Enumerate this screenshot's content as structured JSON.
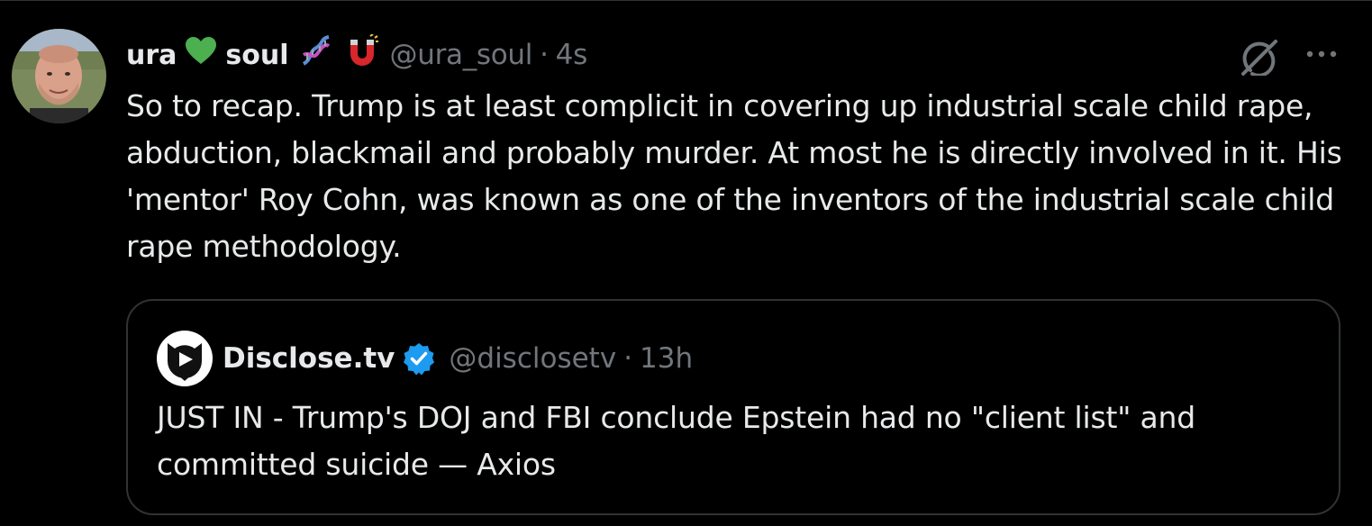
{
  "tweet": {
    "author_name_first": "ura",
    "author_name_second": "soul",
    "handle": "@ura_soul",
    "separator": "·",
    "time": "4s",
    "text": "So to recap. Trump is at least complicit in covering up industrial scale child rape, abduction, blackmail and probably murder. At most he is directly involved in it. His 'mentor' Roy Cohn, was known as one of the inventors of the industrial scale child rape methodology.",
    "name_emojis": [
      "green-heart-icon",
      "dna-icon",
      "magnet-icon"
    ]
  },
  "quote": {
    "author_name": "Disclose.tv",
    "handle": "@disclosetv",
    "separator": "·",
    "time": "13h",
    "text": "JUST IN - Trump's DOJ and FBI conclude Epstein had no \"client list\" and committed suicide — Axios",
    "verified": true
  },
  "actions": {
    "grok_icon": "grok-icon",
    "more_icon": "more-options-icon"
  },
  "colors": {
    "background": "#000000",
    "text_primary": "#e7e9ea",
    "text_secondary": "#71767b",
    "border": "#2f3336",
    "verified": "#1d9bf0",
    "green_heart": "#4caf50"
  }
}
